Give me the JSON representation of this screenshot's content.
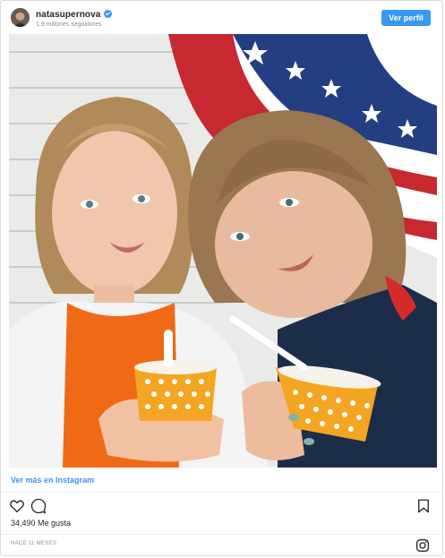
{
  "post": {
    "username": "natasupernova",
    "followers": "1.9 millones seguidores",
    "follow_label": "Ver perfil",
    "more_link": "Ver más en Instagram",
    "likes": "34,490 Me gusta",
    "time_ago": "HACE 11 MESES"
  },
  "icons": {
    "verified": "verified-badge-icon",
    "like": "heart-icon",
    "comment": "comment-bubble-icon",
    "save": "bookmark-icon",
    "brand": "instagram-icon"
  },
  "colors": {
    "accent": "#3897f0",
    "text": "#262626",
    "muted": "#8e8e8e",
    "border": "#dbdbdb"
  }
}
